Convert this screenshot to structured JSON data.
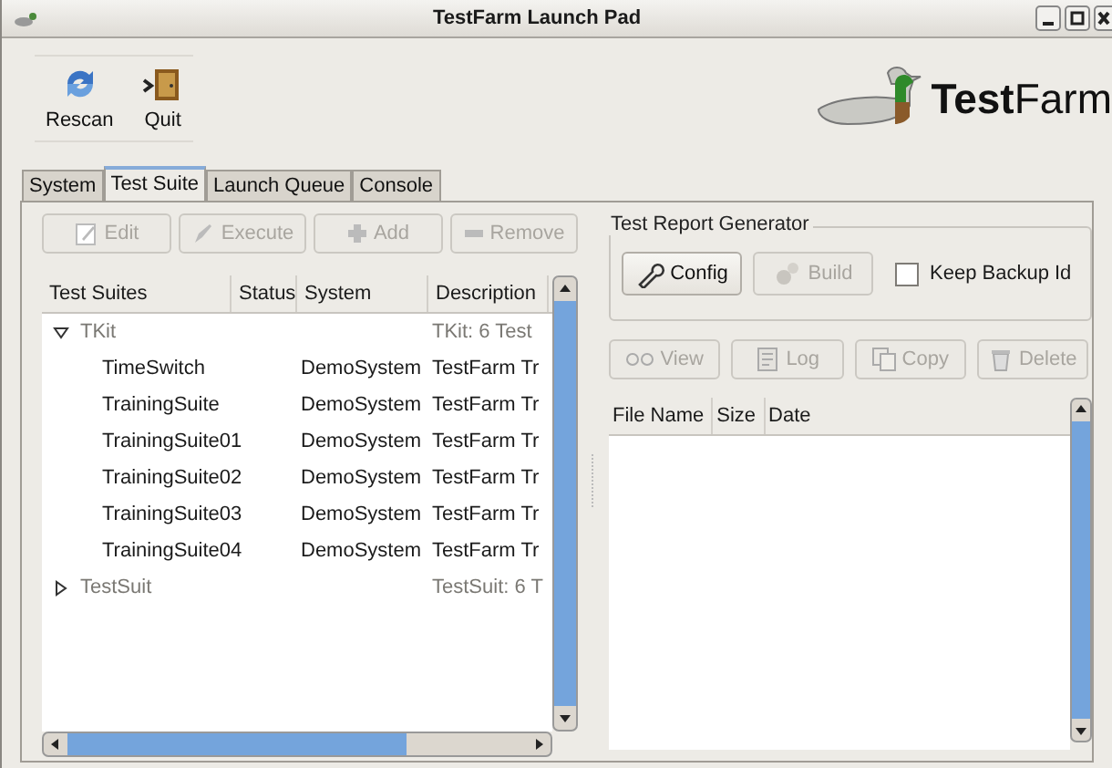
{
  "window": {
    "title": "TestFarm Launch Pad"
  },
  "toolbar": [
    {
      "label": "Rescan",
      "kind": "rescan"
    },
    {
      "label": "Quit",
      "kind": "quit"
    }
  ],
  "logo": {
    "bold": "Test",
    "regular": "Farm"
  },
  "tabs": [
    {
      "label": "System",
      "selected": false
    },
    {
      "label": "Test Suite",
      "selected": true
    },
    {
      "label": "Launch Queue",
      "selected": false
    },
    {
      "label": "Console",
      "selected": false
    }
  ],
  "suite_actions": [
    {
      "label": "Edit",
      "kind": "edit",
      "disabled": true
    },
    {
      "label": "Execute",
      "kind": "execute",
      "disabled": true
    },
    {
      "label": "Add",
      "kind": "add",
      "disabled": true
    },
    {
      "label": "Remove",
      "kind": "remove",
      "disabled": true
    }
  ],
  "suite_tree": {
    "columns": [
      "Test Suites",
      "Status",
      "System",
      "Description"
    ],
    "rows": [
      {
        "name": "TKit",
        "description": "TKit: 6 Test",
        "expanded": true,
        "children": [
          {
            "name": "TimeSwitch",
            "system": "DemoSystem",
            "description": "TestFarm Tr"
          },
          {
            "name": "TrainingSuite",
            "system": "DemoSystem",
            "description": "TestFarm Tr"
          },
          {
            "name": "TrainingSuite01",
            "system": "DemoSystem",
            "description": "TestFarm Tr"
          },
          {
            "name": "TrainingSuite02",
            "system": "DemoSystem",
            "description": "TestFarm Tr"
          },
          {
            "name": "TrainingSuite03",
            "system": "DemoSystem",
            "description": "TestFarm Tr"
          },
          {
            "name": "TrainingSuite04",
            "system": "DemoSystem",
            "description": "TestFarm Tr"
          }
        ]
      },
      {
        "name": "TestSuit",
        "description": "TestSuit: 6 T",
        "expanded": false
      }
    ]
  },
  "report_generator": {
    "title": "Test Report Generator",
    "buttons": [
      {
        "label": "Config",
        "kind": "config",
        "disabled": false
      },
      {
        "label": "Build",
        "kind": "build",
        "disabled": true
      }
    ],
    "keep_backup": {
      "label": "Keep Backup Id",
      "checked": false
    }
  },
  "report_actions": [
    {
      "label": "View",
      "kind": "view",
      "disabled": true
    },
    {
      "label": "Log",
      "kind": "log",
      "disabled": true
    },
    {
      "label": "Copy",
      "kind": "copy",
      "disabled": true
    },
    {
      "label": "Delete",
      "kind": "delete",
      "disabled": true
    }
  ],
  "report_table": {
    "columns": [
      "File Name",
      "Size",
      "Date"
    ]
  }
}
